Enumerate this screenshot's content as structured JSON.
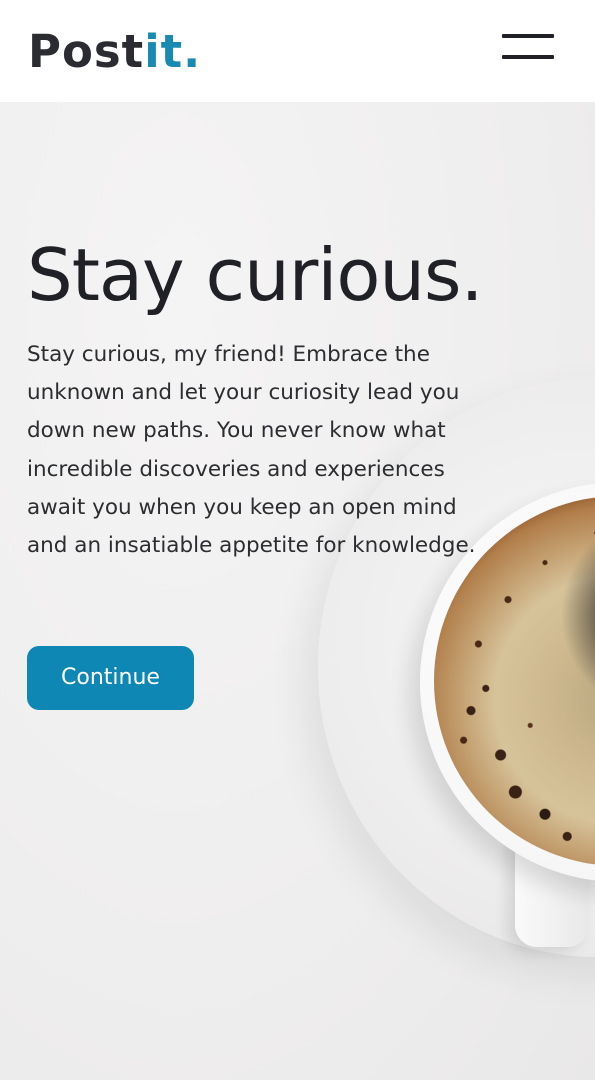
{
  "header": {
    "logo_main": "Post",
    "logo_accent": "it",
    "logo_dot": ".",
    "menu_icon": "hamburger-menu-icon"
  },
  "hero": {
    "title": "Stay curious.",
    "body": "Stay curious, my friend! Embrace the unknown and let your curiosity lead you down new paths. You never know what incredible discoveries and experiences await you when you keep an open mind and an insatiable appetite for knowledge.",
    "cta_label": "Continue",
    "background_image": "coffee-cup-image"
  },
  "colors": {
    "accent": "#1a8ab3",
    "button": "#0e87b4",
    "text": "#1f2127",
    "background": "#efeeee"
  }
}
